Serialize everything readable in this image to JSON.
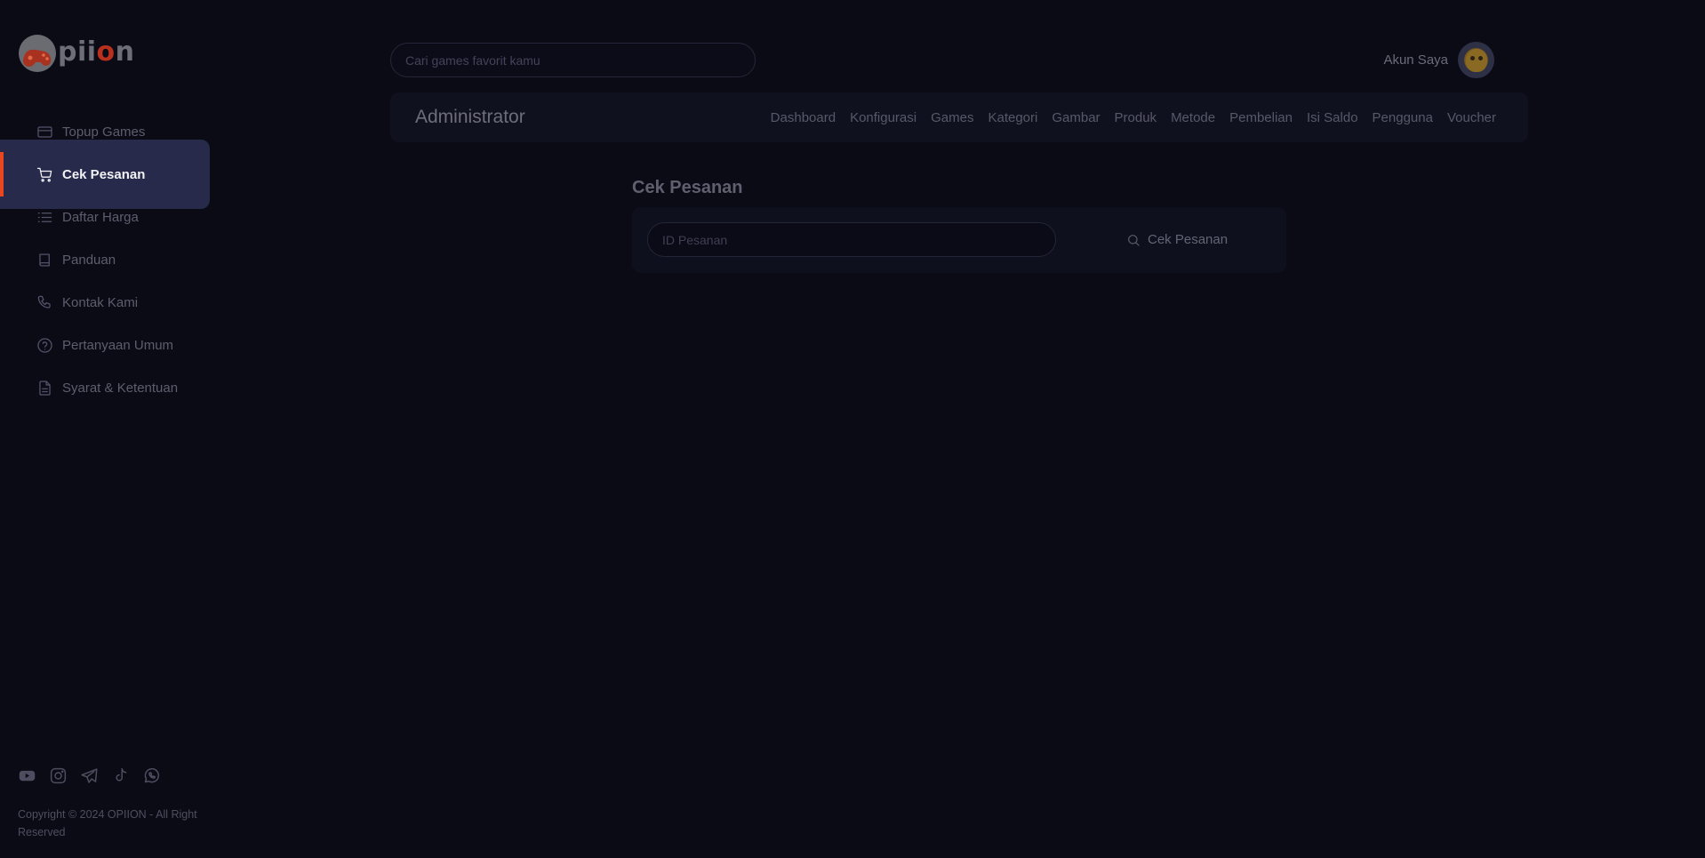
{
  "brand": {
    "name_prefix": "pii",
    "name_accent": "o",
    "name_suffix": "n"
  },
  "sidebar": {
    "items": [
      {
        "label": "Topup Games",
        "icon": "credit-card-icon",
        "active": false
      },
      {
        "label": "Cek Pesanan",
        "icon": "cart-icon",
        "active": true
      },
      {
        "label": "Daftar Harga",
        "icon": "list-icon",
        "active": false
      },
      {
        "label": "Panduan",
        "icon": "book-icon",
        "active": false
      },
      {
        "label": "Kontak Kami",
        "icon": "phone-icon",
        "active": false
      },
      {
        "label": "Pertanyaan Umum",
        "icon": "help-circle-icon",
        "active": false
      },
      {
        "label": "Syarat & Ketentuan",
        "icon": "document-icon",
        "active": false
      }
    ],
    "socials": [
      "youtube-icon",
      "instagram-icon",
      "telegram-icon",
      "tiktok-icon",
      "whatsapp-icon"
    ],
    "copyright": "Copyright © 2024 OPIION - All Right Reserved"
  },
  "header": {
    "search_placeholder": "Cari games favorit kamu",
    "account_label": "Akun Saya"
  },
  "admin": {
    "title": "Administrator",
    "links": [
      "Dashboard",
      "Konfigurasi",
      "Games",
      "Kategori",
      "Gambar",
      "Produk",
      "Metode",
      "Pembelian",
      "Isi Saldo",
      "Pengguna",
      "Voucher"
    ]
  },
  "main": {
    "title": "Cek Pesanan",
    "order_placeholder": "ID Pesanan",
    "button_label": "Cek Pesanan"
  },
  "colors": {
    "background": "#0b0b16",
    "active_item": "#272a4a",
    "accent": "#e8471f",
    "logo_accent": "#b9301e"
  }
}
